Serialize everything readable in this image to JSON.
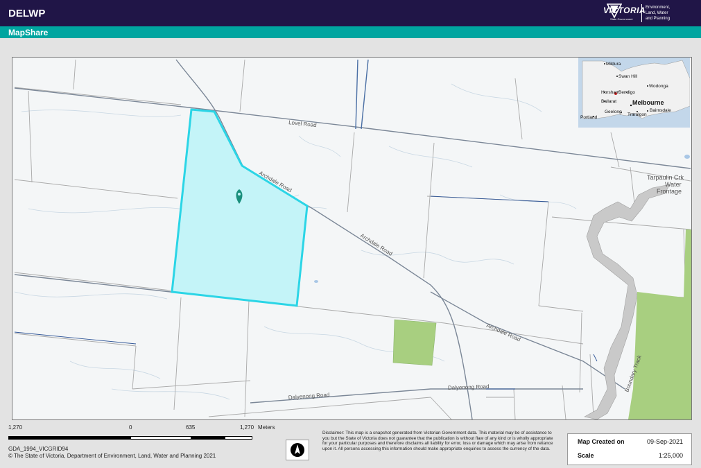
{
  "header": {
    "app_title": "DELWP",
    "logo_word": "VICTORIA",
    "logo_sub": "State Government",
    "logo_dept": "Environment,\nLand, Water\nand Planning"
  },
  "subheader": {
    "title": "MapShare"
  },
  "map": {
    "road_labels": [
      "Lovel Road",
      "Archdale Road",
      "Archdale Road",
      "Archdale Road",
      "Dalyenong Road",
      "Dalyenong Road",
      "Boundary Track"
    ],
    "place_labels": [
      "Tarpaulin Crk",
      "Water",
      "Frontage"
    ],
    "colors": {
      "parcel_fill": "#c4f4f8",
      "parcel_stroke": "#2bd5e6",
      "vegetation": "#a8cf80",
      "waterway": "#c9c9c9",
      "marker": "#1a8f7c"
    },
    "marker_icon": "map-pin-icon"
  },
  "inset_map": {
    "towns": [
      "Mildura",
      "Swan Hill",
      "Wodonga",
      "Horsham",
      "Bendigo",
      "Ballarat",
      "Melbourne",
      "Geelong",
      "Traralgon",
      "Bairnsdale",
      "Portland"
    ]
  },
  "scale_bar": {
    "labels": [
      "1,270",
      "0",
      "635",
      "1,270"
    ],
    "unit": "Meters"
  },
  "footer": {
    "projection": "GDA_1994_VICGRID94",
    "copyright": "© The State of Victoria, Department of Environment, Land, Water and Planning 2021",
    "north_icon": "north-arrow-icon",
    "disclaimer": "Disclaimer: This map is a snapshot generated from Victorian Government data. This material may be of assistance to you but the State of Victoria does not guarantee that the publication is without flaw of any kind or is wholly appropriate for your particular purposes and therefore disclaims all liability for error, loss or damage which may arise from reliance upon it. All persons accessing this information should make appropriate enquiries to assess the currency of the data.",
    "info": {
      "created_label": "Map Created on",
      "created_value": "09-Sep-2021",
      "scale_label": "Scale",
      "scale_value": "1:25,000"
    }
  }
}
